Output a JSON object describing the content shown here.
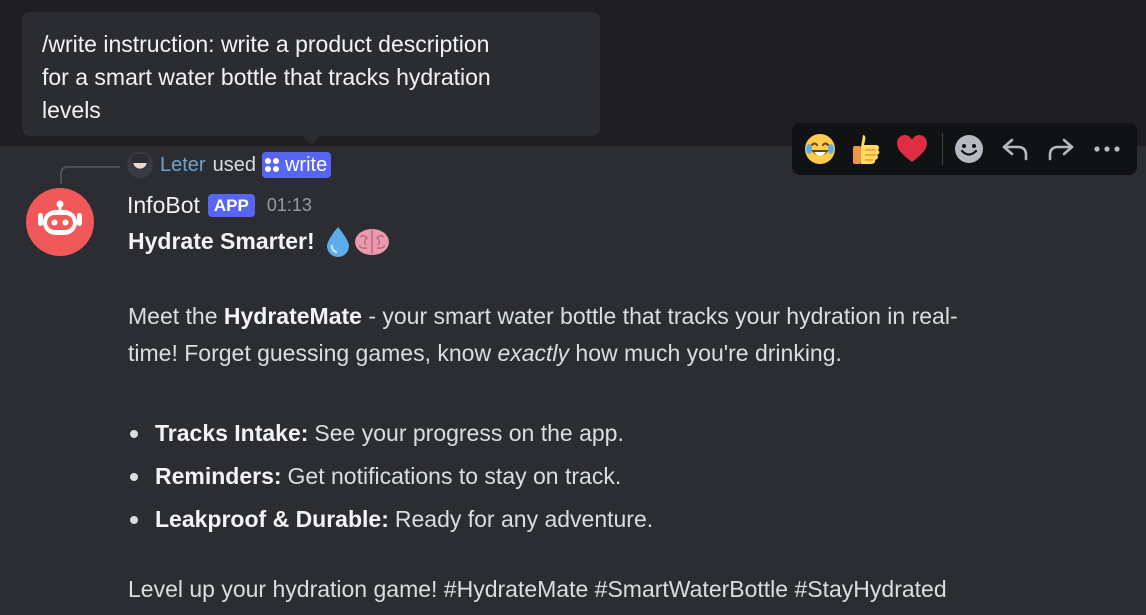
{
  "tooltip": {
    "line1": "/write instruction: write a product description",
    "line2": "for a smart water bottle that tracks hydration",
    "line3": "levels"
  },
  "reply": {
    "user": "Leter",
    "used": "used",
    "command": "write"
  },
  "message": {
    "author": "InfoBot",
    "badge": "APP",
    "timestamp": "01:13",
    "headline": "Hydrate Smarter!",
    "headline_emojis": [
      "water-droplet",
      "brain"
    ],
    "para_1": "Meet the ",
    "para_brand": "HydrateMate",
    "para_2": " - your smart water bottle that tracks your hydration in real-",
    "para_3": "time! Forget guessing games, know ",
    "para_emph": "exactly",
    "para_4": " how much you're drinking.",
    "bullets": [
      {
        "title": "Tracks Intake:",
        "text": "See your progress on the app."
      },
      {
        "title": "Reminders:",
        "text": "Get notifications to stay on track."
      },
      {
        "title": "Leakproof & Durable:",
        "text": "Ready for any adventure."
      }
    ],
    "closing": "Level up your hydration game! #HydrateMate #SmartWaterBottle #StayHydrated"
  },
  "toolbar": {
    "reactions": [
      "joy-emoji",
      "thumbs-up-emoji",
      "red-heart-emoji"
    ],
    "actions": [
      "add-reaction-icon",
      "reply-icon",
      "forward-icon",
      "more-icon"
    ]
  },
  "colors": {
    "accent": "#5865f2",
    "bot_avatar": "#f0585a",
    "username_link": "#6fa1cf"
  }
}
